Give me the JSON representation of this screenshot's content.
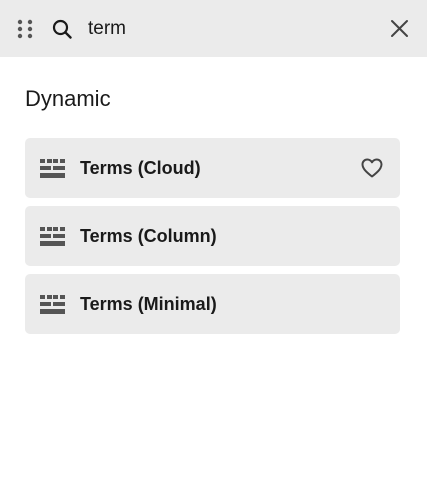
{
  "search": {
    "value": "term"
  },
  "section": {
    "title": "Dynamic"
  },
  "items": [
    {
      "label": "Terms (Cloud)",
      "favorite_visible": true
    },
    {
      "label": "Terms (Column)",
      "favorite_visible": false
    },
    {
      "label": "Terms (Minimal)",
      "favorite_visible": false
    }
  ],
  "icons": {
    "drag": "drag-handle-icon",
    "search": "search-icon",
    "close": "close-icon",
    "widget": "terms-widget-icon",
    "favorite": "heart-icon"
  },
  "colors": {
    "header_bg": "#ebebeb",
    "item_bg": "#ebebeb",
    "icon": "#555555",
    "text": "#1a1a1a"
  }
}
